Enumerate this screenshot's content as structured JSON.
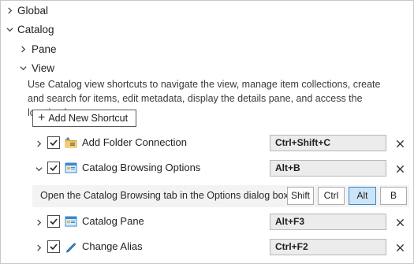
{
  "tree": {
    "global_label": "Global",
    "catalog_label": "Catalog",
    "pane_label": "Pane",
    "view_label": "View"
  },
  "view_section": {
    "description": "Use Catalog view shortcuts to navigate the view, manage item collections, create and search for items, edit metadata, display the details pane, and access the location bar.",
    "add_button_label": "Add New Shortcut"
  },
  "shortcuts": [
    {
      "label": "Add Folder Connection",
      "keys": "Ctrl+Shift+C",
      "checked": true,
      "expanded": false,
      "icon": "folder-connection-icon"
    },
    {
      "label": "Catalog Browsing Options",
      "keys": "Alt+B",
      "checked": true,
      "expanded": true,
      "icon": "catalog-window-icon"
    },
    {
      "label": "Catalog Pane",
      "keys": "Alt+F3",
      "checked": true,
      "expanded": false,
      "icon": "catalog-window-icon"
    },
    {
      "label": "Change Alias",
      "keys": "Ctrl+F2",
      "checked": true,
      "expanded": false,
      "icon": "pencil-icon"
    }
  ],
  "detail": {
    "text": "Open the Catalog Browsing tab in the Options dialog box.",
    "modifiers": [
      {
        "label": "Shift",
        "active": false
      },
      {
        "label": "Ctrl",
        "active": false
      },
      {
        "label": "Alt",
        "active": true
      },
      {
        "label": "B",
        "active": false
      }
    ]
  },
  "colors": {
    "accent": "#3a88c8",
    "active_key_bg": "#cce4f7",
    "key_field_bg": "#ececec",
    "detail_bg": "#f3f3f3"
  }
}
